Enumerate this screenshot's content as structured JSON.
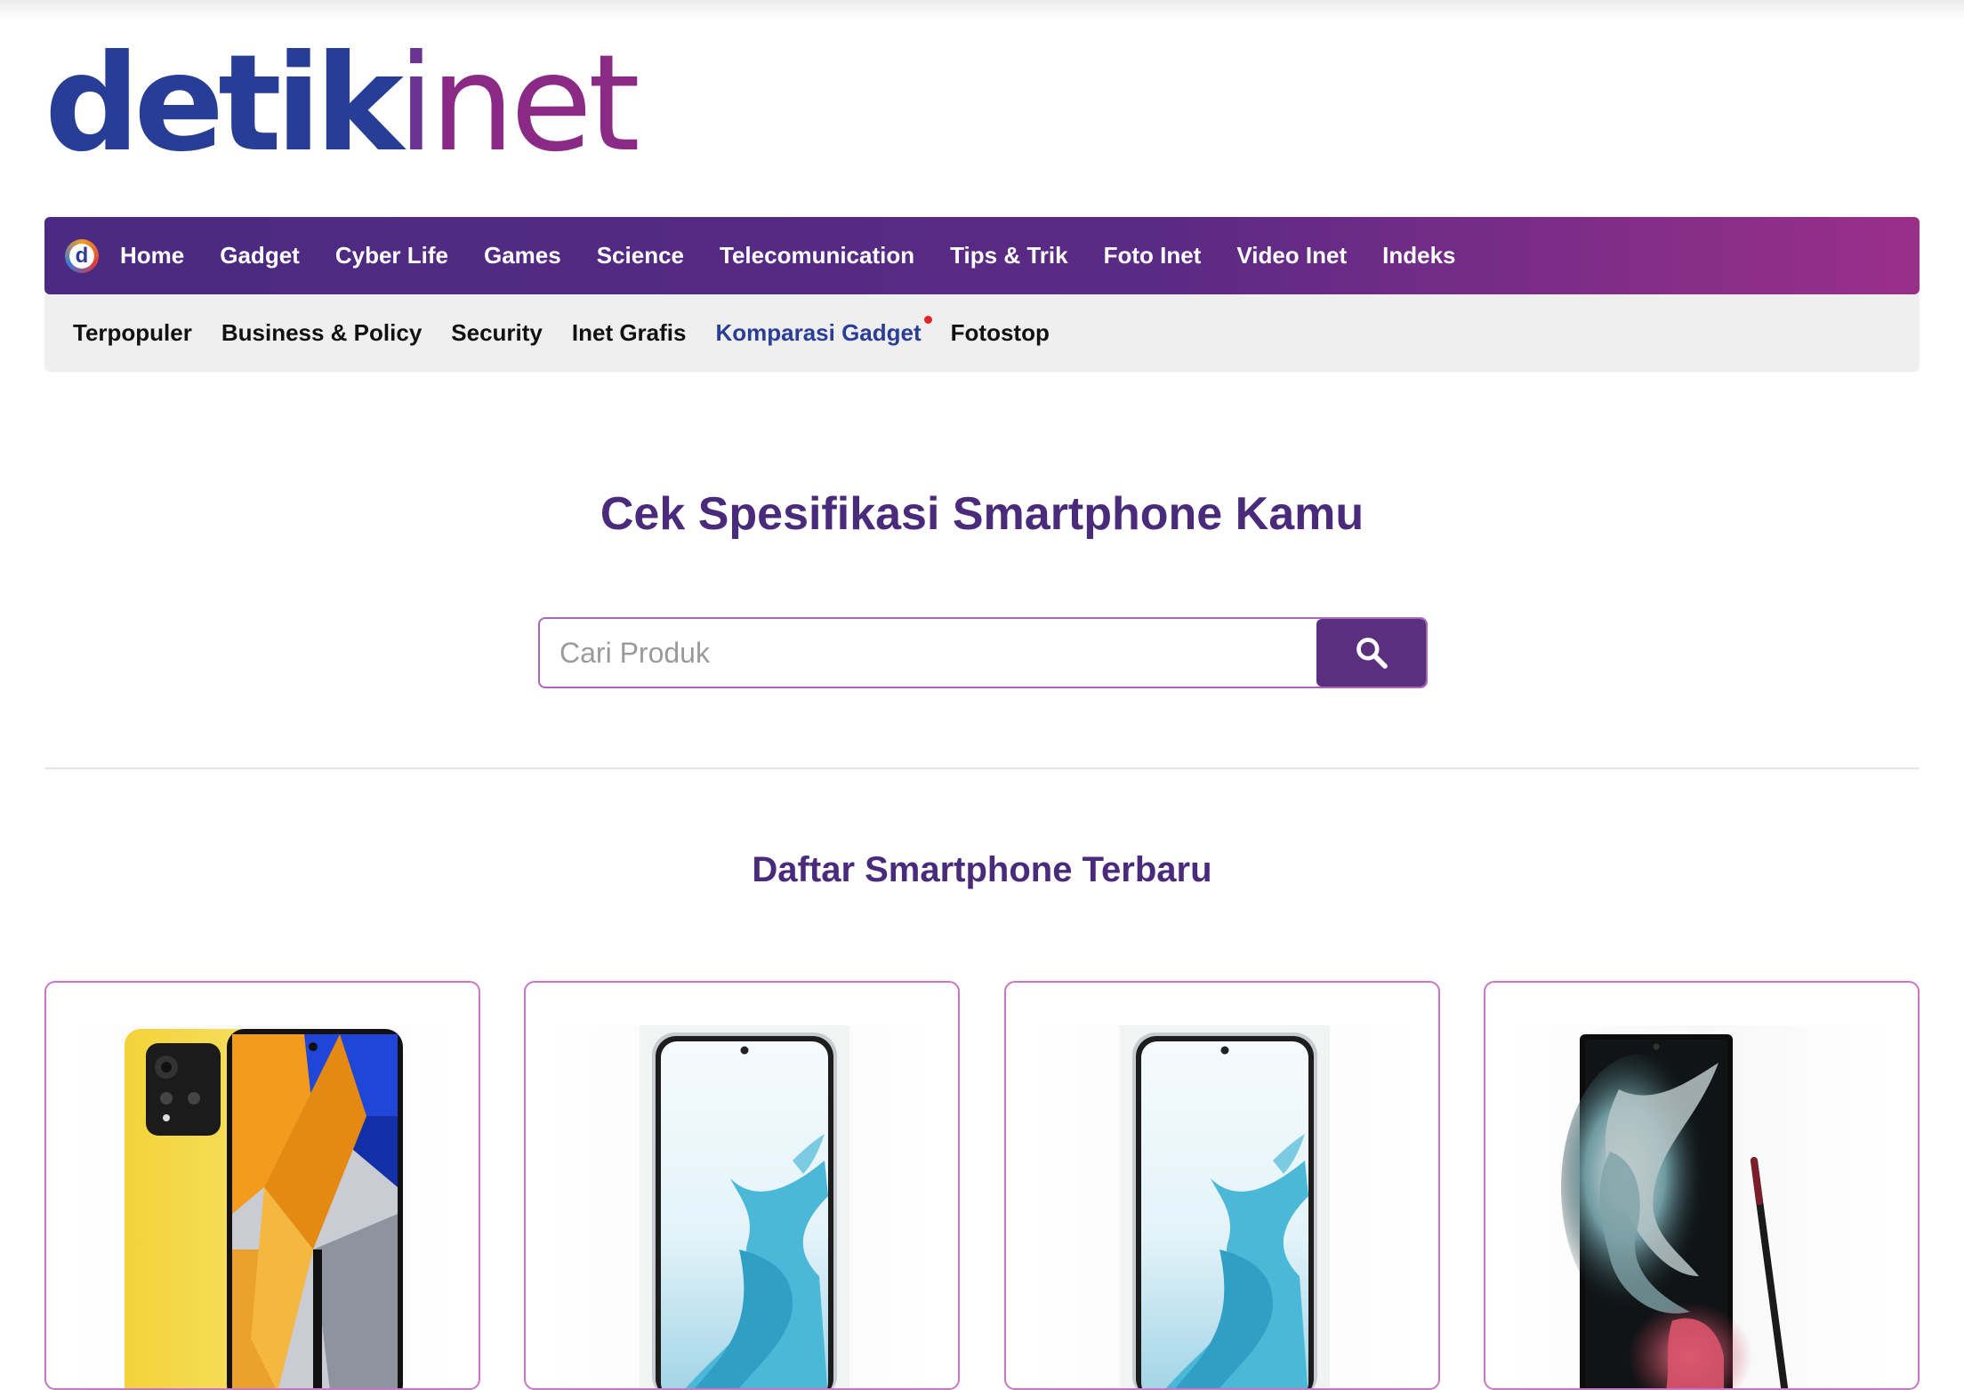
{
  "brand": {
    "part1": "detik",
    "part2_i": "i",
    "part2_rest": "net"
  },
  "main_nav": {
    "items": [
      "Home",
      "Gadget",
      "Cyber Life",
      "Games",
      "Science",
      "Telecomunication",
      "Tips & Trik",
      "Foto Inet",
      "Video Inet",
      "Indeks"
    ]
  },
  "sub_nav": {
    "items": [
      "Terpopuler",
      "Business & Policy",
      "Security",
      "Inet Grafis",
      "Komparasi Gadget",
      "Fotostop"
    ],
    "active": "Komparasi Gadget"
  },
  "hero": {
    "title": "Cek Spesifikasi Smartphone Kamu"
  },
  "search": {
    "placeholder": "Cari Produk",
    "value": ""
  },
  "latest": {
    "title": "Daftar Smartphone Terbaru",
    "products": [
      {
        "image": "yellow-phone-image"
      },
      {
        "image": "white-phone-image"
      },
      {
        "image": "white-phone-image"
      },
      {
        "image": "black-phone-stylus-image"
      }
    ]
  },
  "colors": {
    "brand_blue": "#283e96",
    "brand_purple": "#5a2f7e",
    "accent_magenta": "#9a2f8a",
    "card_border": "#c777c3",
    "active_dot": "#e3252a"
  }
}
